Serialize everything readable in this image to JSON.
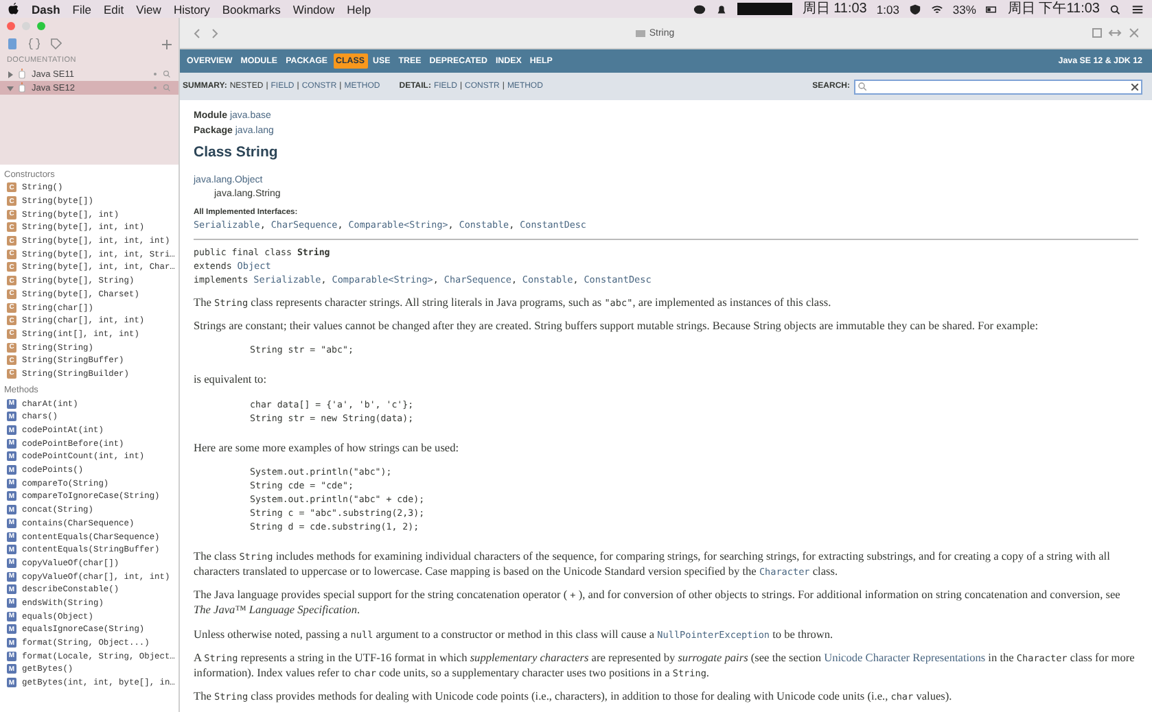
{
  "menu_bar": {
    "app": "Dash",
    "items": [
      "File",
      "Edit",
      "View",
      "History",
      "Bookmarks",
      "Window",
      "Help"
    ],
    "status": [
      "周日 11:03",
      "1:03",
      "33%",
      "周日 下午11:03"
    ]
  },
  "window": {
    "title": "String"
  },
  "sidebar": {
    "section_label": "DOCUMENTATION",
    "docsets": [
      {
        "label": "Java SE11",
        "expanded": false,
        "selected": false
      },
      {
        "label": "Java SE12",
        "expanded": true,
        "selected": true
      }
    ],
    "groups": [
      {
        "title": "Constructors",
        "kind": "constructor",
        "items": [
          {
            "badge": "C",
            "label": "String()"
          },
          {
            "badge": "C",
            "label": "String(byte[])"
          },
          {
            "badge": "C",
            "label": "String(byte[], int)"
          },
          {
            "badge": "C",
            "label": "String(byte[], int, int)"
          },
          {
            "badge": "C",
            "label": "String(byte[], int, int, int)"
          },
          {
            "badge": "C",
            "label": "String(byte[], int, int, Stri…"
          },
          {
            "badge": "C",
            "label": "String(byte[], int, int, Char…"
          },
          {
            "badge": "C",
            "label": "String(byte[], String)"
          },
          {
            "badge": "C",
            "label": "String(byte[], Charset)"
          },
          {
            "badge": "C",
            "label": "String(char[])"
          },
          {
            "badge": "C",
            "label": "String(char[], int, int)"
          },
          {
            "badge": "C",
            "label": "String(int[], int, int)"
          },
          {
            "badge": "C",
            "label": "String(String)"
          },
          {
            "badge": "C",
            "label": "String(StringBuffer)"
          },
          {
            "badge": "C",
            "label": "String(StringBuilder)"
          }
        ]
      },
      {
        "title": "Methods",
        "kind": "method",
        "items": [
          {
            "badge": "M",
            "label": "charAt(int)"
          },
          {
            "badge": "M",
            "label": "chars()"
          },
          {
            "badge": "M",
            "label": "codePointAt(int)"
          },
          {
            "badge": "M",
            "label": "codePointBefore(int)"
          },
          {
            "badge": "M",
            "label": "codePointCount(int, int)"
          },
          {
            "badge": "M",
            "label": "codePoints()"
          },
          {
            "badge": "M",
            "label": "compareTo(String)"
          },
          {
            "badge": "M",
            "label": "compareToIgnoreCase(String)"
          },
          {
            "badge": "M",
            "label": "concat(String)"
          },
          {
            "badge": "M",
            "label": "contains(CharSequence)"
          },
          {
            "badge": "M",
            "label": "contentEquals(CharSequence)"
          },
          {
            "badge": "M",
            "label": "contentEquals(StringBuffer)"
          },
          {
            "badge": "M",
            "label": "copyValueOf(char[])"
          },
          {
            "badge": "M",
            "label": "copyValueOf(char[], int, int)"
          },
          {
            "badge": "M",
            "label": "describeConstable()"
          },
          {
            "badge": "M",
            "label": "endsWith(String)"
          },
          {
            "badge": "M",
            "label": "equals(Object)"
          },
          {
            "badge": "M",
            "label": "equalsIgnoreCase(String)"
          },
          {
            "badge": "M",
            "label": "format(String, Object...)"
          },
          {
            "badge": "M",
            "label": "format(Locale, String, Object…"
          },
          {
            "badge": "M",
            "label": "getBytes()"
          },
          {
            "badge": "M",
            "label": "getBytes(int, int, byte[], in…"
          }
        ]
      }
    ]
  },
  "nav": {
    "items": [
      {
        "label": "OVERVIEW",
        "selected": false
      },
      {
        "label": "MODULE",
        "selected": false
      },
      {
        "label": "PACKAGE",
        "selected": false
      },
      {
        "label": "CLASS",
        "selected": true
      },
      {
        "label": "USE",
        "selected": false
      },
      {
        "label": "TREE",
        "selected": false
      },
      {
        "label": "DEPRECATED",
        "selected": false
      },
      {
        "label": "INDEX",
        "selected": false
      },
      {
        "label": "HELP",
        "selected": false
      }
    ],
    "version": "Java SE 12 & JDK 12"
  },
  "subnav": {
    "separator": "|",
    "groups": [
      {
        "label": "SUMMARY:",
        "items": [
          {
            "label": "NESTED",
            "link": false
          },
          {
            "label": "FIELD",
            "link": true
          },
          {
            "label": "CONSTR",
            "link": true
          },
          {
            "label": "METHOD",
            "link": true
          }
        ]
      },
      {
        "label": "DETAIL:",
        "items": [
          {
            "label": "FIELD",
            "link": true
          },
          {
            "label": "CONSTR",
            "link": true
          },
          {
            "label": "METHOD",
            "link": true
          }
        ]
      }
    ],
    "search": {
      "label": "SEARCH:"
    }
  },
  "header": {
    "module_label": "Module",
    "module": "java.base",
    "package_label": "Package",
    "package": "java.lang",
    "title": "Class String",
    "inheritance": [
      "java.lang.Object",
      "java.lang.String"
    ],
    "interfaces_label": "All Implemented Interfaces:",
    "interfaces": [
      "Serializable",
      "CharSequence",
      "Comparable<String>",
      "Constable",
      "ConstantDesc"
    ],
    "interfaces_separator": ", "
  },
  "blocks": [
    {
      "kind": "declaration",
      "segments": [
        {
          "kind": "text",
          "text": "public final class "
        },
        {
          "kind": "bold",
          "text": "String"
        },
        {
          "kind": "text",
          "text": "\nextends "
        },
        {
          "kind": "link",
          "text": "Object"
        },
        {
          "kind": "text",
          "text": "\nimplements "
        },
        {
          "kind": "link",
          "text": "Serializable"
        },
        {
          "kind": "text",
          "text": ", "
        },
        {
          "kind": "link",
          "text": "Comparable<String>"
        },
        {
          "kind": "text",
          "text": ", "
        },
        {
          "kind": "link",
          "text": "CharSequence"
        },
        {
          "kind": "text",
          "text": ", "
        },
        {
          "kind": "link",
          "text": "Constable"
        },
        {
          "kind": "text",
          "text": ", "
        },
        {
          "kind": "link",
          "text": "ConstantDesc"
        }
      ]
    },
    {
      "kind": "para",
      "segments": [
        {
          "kind": "text",
          "text": "The "
        },
        {
          "kind": "code",
          "text": "String"
        },
        {
          "kind": "text",
          "text": " class represents character strings. All string literals in Java programs, such as "
        },
        {
          "kind": "code",
          "text": "\"abc\""
        },
        {
          "kind": "text",
          "text": ", are implemented as instances of this class."
        }
      ]
    },
    {
      "kind": "para",
      "segments": [
        {
          "kind": "text",
          "text": "Strings are constant; their values cannot be changed after they are created. String buffers support mutable strings. Because String objects are immutable they can be shared. For example:"
        }
      ]
    },
    {
      "kind": "code",
      "text": "String str = \"abc\";"
    },
    {
      "kind": "para",
      "segments": [
        {
          "kind": "text",
          "text": "is equivalent to:"
        }
      ]
    },
    {
      "kind": "code",
      "text": "char data[] = {'a', 'b', 'c'};\nString str = new String(data);"
    },
    {
      "kind": "para",
      "segments": [
        {
          "kind": "text",
          "text": "Here are some more examples of how strings can be used:"
        }
      ]
    },
    {
      "kind": "code",
      "text": "System.out.println(\"abc\");\nString cde = \"cde\";\nSystem.out.println(\"abc\" + cde);\nString c = \"abc\".substring(2,3);\nString d = cde.substring(1, 2);"
    },
    {
      "kind": "para",
      "segments": [
        {
          "kind": "text",
          "text": "The class "
        },
        {
          "kind": "code",
          "text": "String"
        },
        {
          "kind": "text",
          "text": " includes methods for examining individual characters of the sequence, for comparing strings, for searching strings, for extracting substrings, and for creating a copy of a string with all characters translated to uppercase or to lowercase. Case mapping is based on the Unicode Standard version specified by the "
        },
        {
          "kind": "link",
          "text": "Character"
        },
        {
          "kind": "text",
          "text": " class."
        }
      ]
    },
    {
      "kind": "para",
      "segments": [
        {
          "kind": "text",
          "text": "The Java language provides special support for the string concatenation operator ( "
        },
        {
          "kind": "code",
          "text": "+"
        },
        {
          "kind": "text",
          "text": " ), and for conversion of other objects to strings. For additional information on string concatenation and conversion, see "
        },
        {
          "kind": "em",
          "text": "The Java™ Language Specification"
        },
        {
          "kind": "text",
          "text": "."
        }
      ]
    },
    {
      "kind": "para",
      "segments": [
        {
          "kind": "text",
          "text": "Unless otherwise noted, passing a "
        },
        {
          "kind": "code",
          "text": "null"
        },
        {
          "kind": "text",
          "text": " argument to a constructor or method in this class will cause a "
        },
        {
          "kind": "link",
          "text": "NullPointerException"
        },
        {
          "kind": "text",
          "text": " to be thrown."
        }
      ]
    },
    {
      "kind": "para",
      "segments": [
        {
          "kind": "text",
          "text": "A "
        },
        {
          "kind": "code",
          "text": "String"
        },
        {
          "kind": "text",
          "text": " represents a string in the UTF-16 format in which "
        },
        {
          "kind": "em",
          "text": "supplementary characters"
        },
        {
          "kind": "text",
          "text": " are represented by "
        },
        {
          "kind": "em",
          "text": "surrogate pairs"
        },
        {
          "kind": "text",
          "text": " (see the section "
        },
        {
          "kind": "textlink",
          "text": "Unicode Character Representations"
        },
        {
          "kind": "text",
          "text": " in the "
        },
        {
          "kind": "code",
          "text": "Character"
        },
        {
          "kind": "text",
          "text": " class for more information). Index values refer to "
        },
        {
          "kind": "code",
          "text": "char"
        },
        {
          "kind": "text",
          "text": " code units, so a supplementary character uses two positions in a "
        },
        {
          "kind": "code",
          "text": "String"
        },
        {
          "kind": "text",
          "text": "."
        }
      ]
    },
    {
      "kind": "para",
      "segments": [
        {
          "kind": "text",
          "text": "The "
        },
        {
          "kind": "code",
          "text": "String"
        },
        {
          "kind": "text",
          "text": " class provides methods for dealing with Unicode code points (i.e., characters), in addition to those for dealing with Unicode code units (i.e., "
        },
        {
          "kind": "code",
          "text": "char"
        },
        {
          "kind": "text",
          "text": " values)."
        }
      ]
    }
  ]
}
